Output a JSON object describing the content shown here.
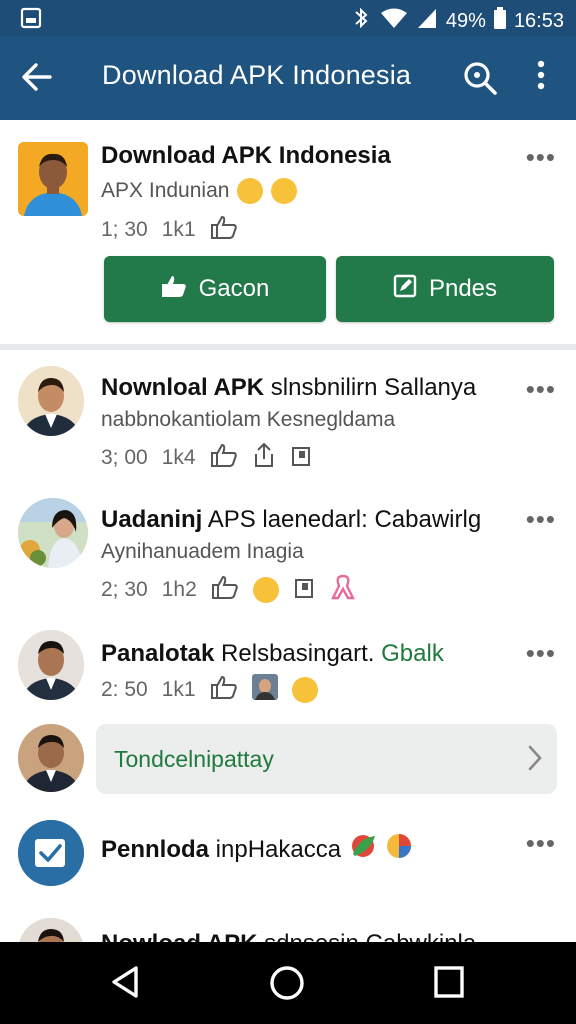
{
  "status": {
    "battery": "49%",
    "time": "16:53"
  },
  "appbar": {
    "title": "Download APK Indonesia"
  },
  "items": [
    {
      "title": "Download APK Indonesia",
      "subtitle": "APX Indunian",
      "time": "1; 30",
      "count": "1k1",
      "buttons": [
        "Gacon",
        "Pndes"
      ]
    },
    {
      "title_bold": "Nownloal APK",
      "title_rest": " slnsbnilirn Sallanya",
      "subtitle": "nabbnokantiolam Kesnegldama",
      "time": "3; 00",
      "count": "1k4"
    },
    {
      "title_bold": "Uadaninj",
      "title_rest": " APS laenedarl: Cabawirlg",
      "subtitle": "Aynihanuadem Inagia",
      "time": "2; 30",
      "count": "1h2"
    },
    {
      "title_bold": "Panalotak",
      "title_rest": " Relsbasingart.",
      "title_green": " Gbalk",
      "time": "2: 50",
      "count": "1k1",
      "reply_placeholder": "Tondcelnipattay"
    },
    {
      "title_bold": "Pennloda",
      "title_rest": " inpHakacca"
    },
    {
      "title_bold": "Nowload APK",
      "title_rest": " sdnsesin Cabwkinla"
    }
  ],
  "colors": {
    "appbar": "#1f5480",
    "primary_button": "#22794a",
    "accent_text": "#1f7a3c"
  },
  "icons": [
    "gallery-icon",
    "bluetooth-icon",
    "wifi-icon",
    "signal-icon",
    "back-arrow-icon",
    "search-icon",
    "more-vert-icon",
    "thumbs-up-icon",
    "share-icon",
    "flag-icon",
    "ribbon-icon",
    "checkbox-app-icon",
    "chevron-right-icon",
    "nav-back-icon",
    "nav-home-icon",
    "nav-recents-icon"
  ]
}
